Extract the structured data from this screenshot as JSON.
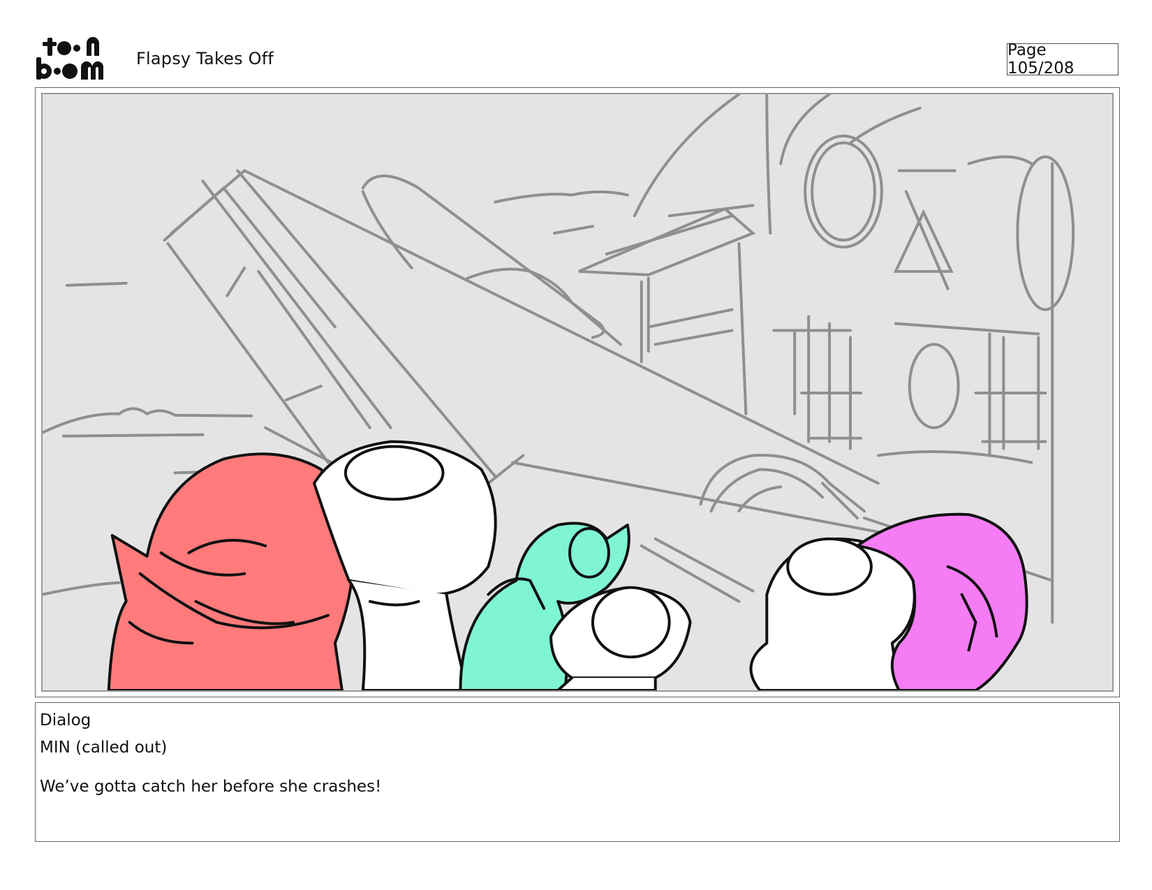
{
  "header": {
    "logo_alt": "toonboom",
    "title": "Flapsy Takes Off",
    "page": "Page 105/208"
  },
  "panel": {
    "background_color": "#e4e4e4",
    "sketch_color": "#8f8f8f",
    "ink_color": "#111111",
    "character_colors": [
      "#ff7b7b",
      "#ffffff",
      "#7ff5d4",
      "#ffffff",
      "#ffffff",
      "#f57cf5"
    ]
  },
  "dialog": {
    "heading": "Dialog",
    "speaker": "MIN (called out)",
    "line": "We’ve gotta catch her before she crashes!"
  }
}
